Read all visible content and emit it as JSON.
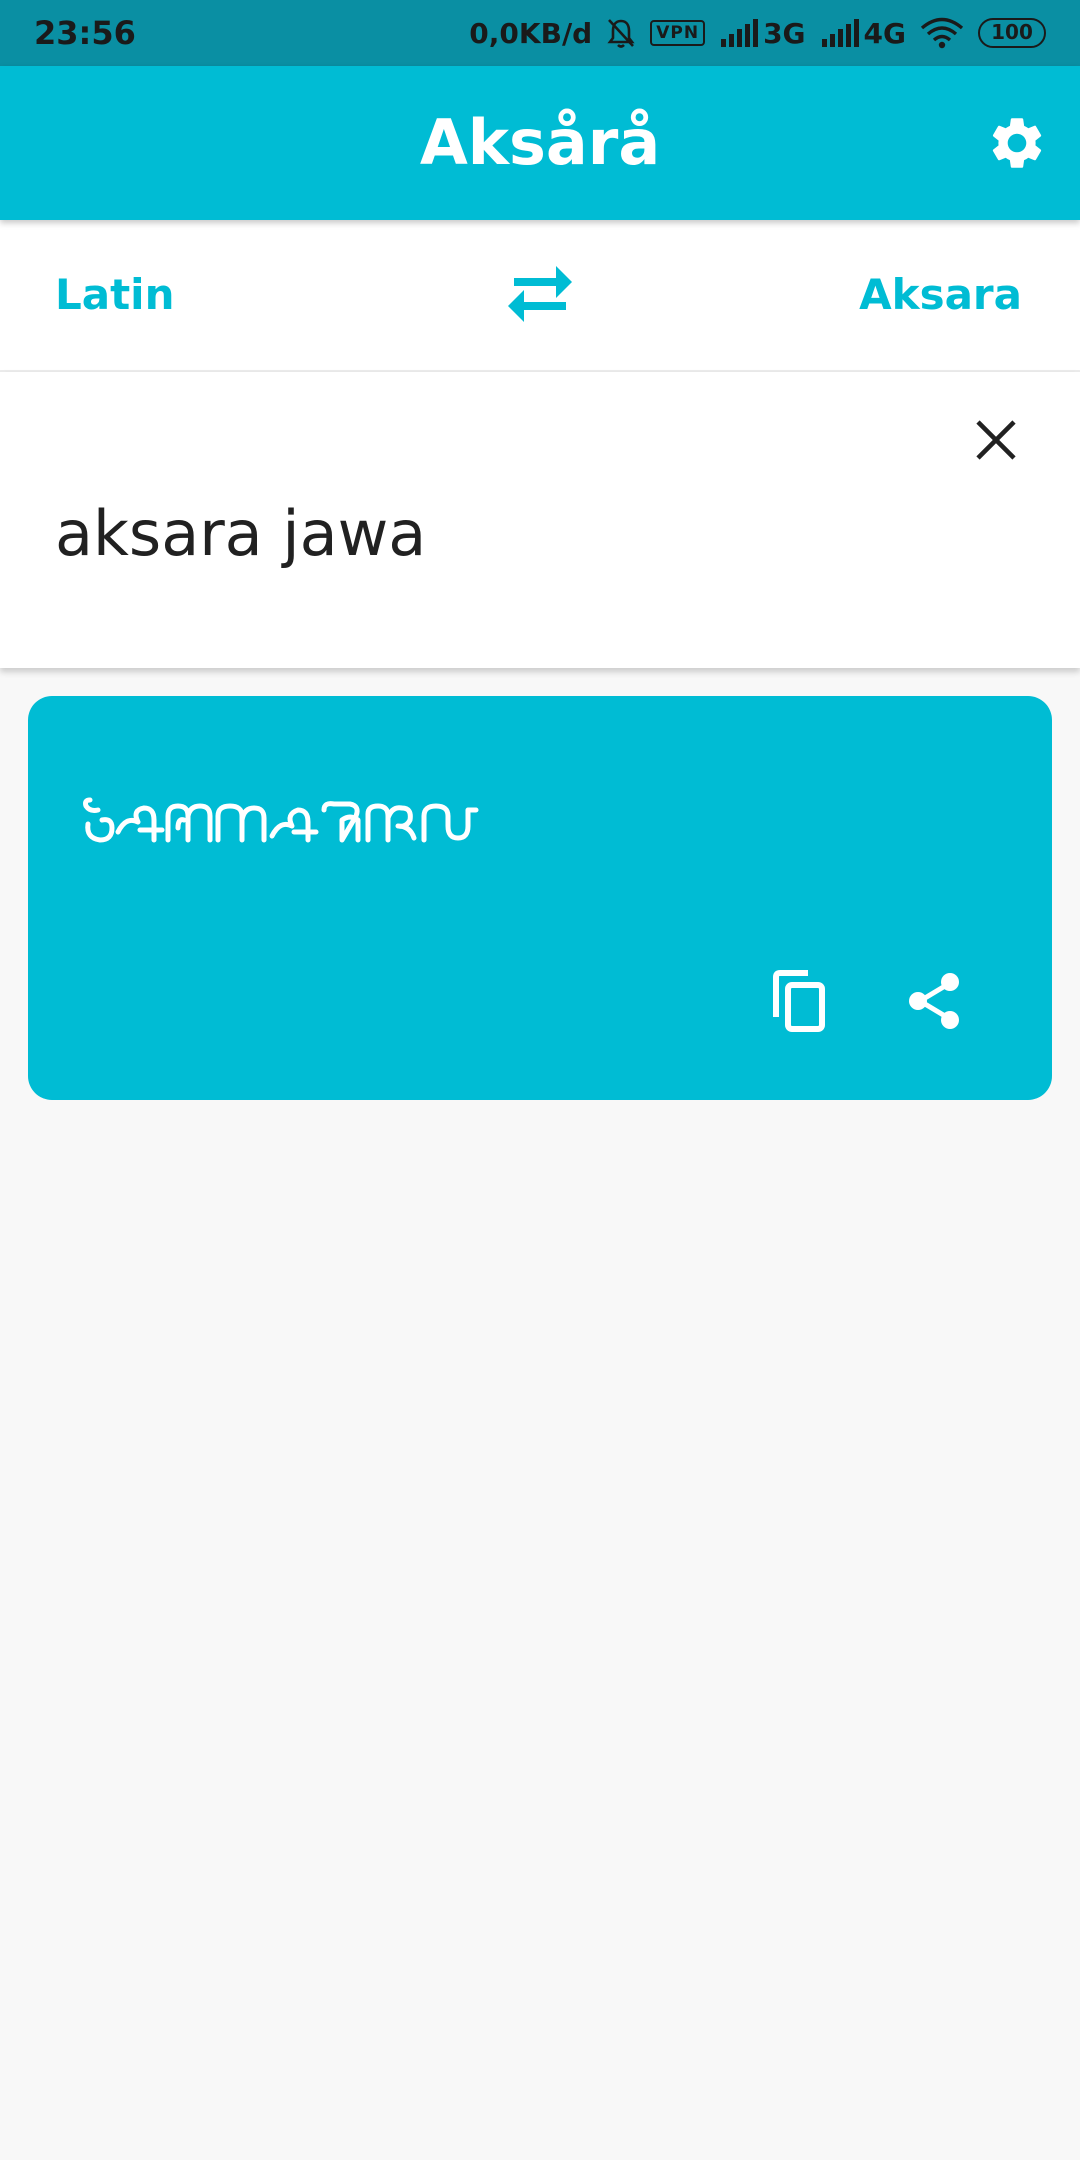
{
  "status_bar": {
    "time": "23:56",
    "data_speed": "0,0KB/d",
    "vpn_label": "VPN",
    "network_1": "3G",
    "network_2": "4G",
    "battery": "100",
    "icons": [
      "mute-bell-icon",
      "signal-icon",
      "signal-icon",
      "wifi-icon"
    ]
  },
  "app_bar": {
    "title": "Aksårå",
    "settings_icon": "gear-icon"
  },
  "language_bar": {
    "source": "Latin",
    "target": "Aksara",
    "swap_icon": "swap-arrows-icon"
  },
  "input": {
    "value": "aksara jawa",
    "clear_icon": "close-icon"
  },
  "result": {
    "text_icon": "javanese-script-glyphs",
    "copy_icon": "copy-icon",
    "share_icon": "share-icon"
  },
  "colors": {
    "primary": "#00bcd4",
    "status_bar": "#0a8fa3",
    "background": "#f8f8f8",
    "text_dark": "#212121"
  }
}
